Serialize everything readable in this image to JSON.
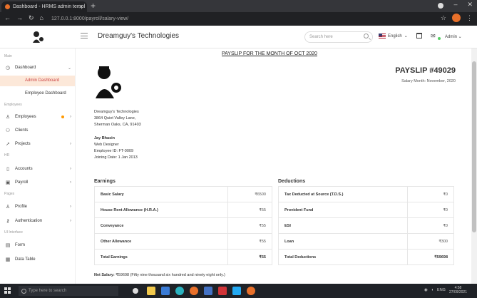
{
  "browser": {
    "tab_title": "Dashboard - HRMS admin templ",
    "url": "127.0.0.1:8000/payroll/salary-view/",
    "lang_label": "English",
    "admin_label": "Admin"
  },
  "header": {
    "company": "Dreamguy's Technologies",
    "search_placeholder": "Search here"
  },
  "sidebar": {
    "sections": [
      "Main",
      "Employees",
      "HR",
      "Pages",
      "UI Interface"
    ],
    "items": [
      {
        "label": "Dashboard"
      },
      {
        "label": "Admin Dashboard"
      },
      {
        "label": "Employee Dashboard"
      },
      {
        "label": "Employees"
      },
      {
        "label": "Clients"
      },
      {
        "label": "Projects"
      },
      {
        "label": "Accounts"
      },
      {
        "label": "Payroll"
      },
      {
        "label": "Profile"
      },
      {
        "label": "Authentication"
      },
      {
        "label": "Form"
      },
      {
        "label": "Data Table"
      }
    ]
  },
  "payslip": {
    "title": "PAYSLIP FOR THE MONTH OF OCT 2020",
    "number": "PAYSLIP #49029",
    "salary_month": "Salary Month: November, 2020",
    "company_name": "Dreamguy's Technologies",
    "address_1": "3864 Quiet Valley Lane,",
    "address_2": "Sherman Oaks, CA, 91403",
    "employee_name": "Jay Bhasin",
    "designation": "Web Designer",
    "employee_id": "Employee ID: FT-0009",
    "joining_date": "Joining Date: 1 Jan 2013"
  },
  "earnings": {
    "heading": "Earnings",
    "rows": [
      {
        "label": "Basic Salary",
        "value": "₹6500"
      },
      {
        "label": "House Rent Allowance (H.R.A.)",
        "value": "₹55"
      },
      {
        "label": "Conveyance",
        "value": "₹55"
      },
      {
        "label": "Other Allowance",
        "value": "₹55"
      },
      {
        "label": "Total Earnings",
        "value": "₹55"
      }
    ]
  },
  "deductions": {
    "heading": "Deductions",
    "rows": [
      {
        "label": "Tax Deducted at Source (T.D.S.)",
        "value": "₹0"
      },
      {
        "label": "Provident Fund",
        "value": "₹0"
      },
      {
        "label": "ESI",
        "value": "₹0"
      },
      {
        "label": "Loan",
        "value": "₹300"
      },
      {
        "label": "Total Deductions",
        "value": "₹59698"
      }
    ]
  },
  "net_salary": {
    "label": "Net Salary:",
    "value": "₹59698 (Fifty nine thousand six hundred and ninety eight only.)"
  },
  "taskbar": {
    "search_placeholder": "Type here to search",
    "lang": "ENG",
    "time": "4:58",
    "date": "27/09/2021"
  },
  "colors": {
    "accent": "#e8702a",
    "active_bg": "#fce8d9"
  }
}
